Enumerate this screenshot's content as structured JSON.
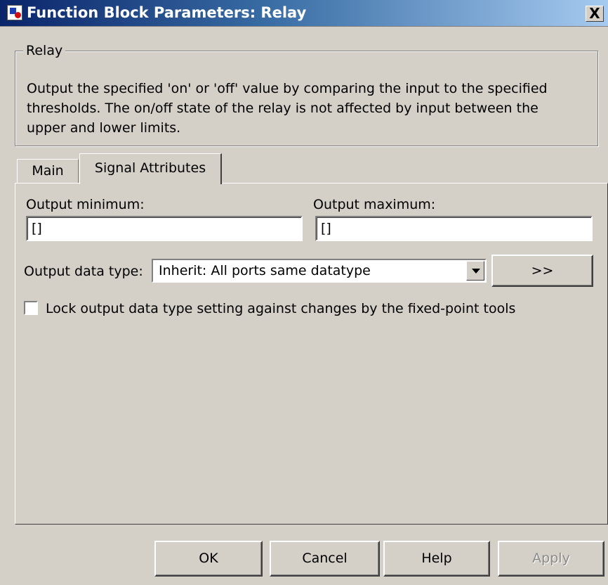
{
  "window": {
    "title": "Function Block Parameters: Relay",
    "close_label": "X"
  },
  "group": {
    "legend": "Relay",
    "description": "Output the specified 'on' or 'off' value by comparing the input to the specified thresholds.  The on/off state of the relay is not affected by input between the upper and lower limits."
  },
  "tabs": [
    {
      "label": "Main",
      "selected": false
    },
    {
      "label": "Signal Attributes",
      "selected": true
    }
  ],
  "fields": {
    "output_minimum": {
      "label": "Output minimum:",
      "value": "[]"
    },
    "output_maximum": {
      "label": "Output maximum:",
      "value": "[]"
    },
    "output_data_type": {
      "label": "Output data type:",
      "value": "Inherit: All ports same datatype"
    },
    "assistant_button": ">>",
    "lock_checkbox": {
      "label": "Lock output data type setting against changes by the fixed-point tools",
      "checked": false
    }
  },
  "buttons": {
    "ok": "OK",
    "cancel": "Cancel",
    "help": "Help",
    "apply": "Apply"
  },
  "colors": {
    "dialog_bg": "#d4d0c8",
    "titlebar_start": "#0a246a",
    "titlebar_end": "#a6caf0"
  }
}
